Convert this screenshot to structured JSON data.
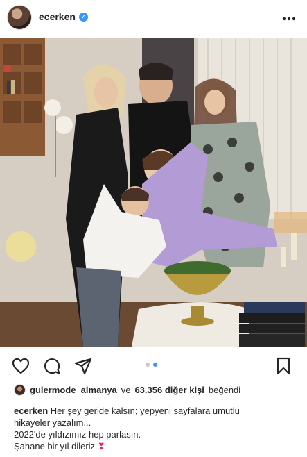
{
  "post": {
    "username": "ecerken",
    "verified_mark": "✓",
    "more_icon": "more-icon",
    "liked_by_user": "gulermode_almanya",
    "likes_connector": "ve",
    "likes_count_text": "63.356 diğer kişi",
    "likes_suffix": "beğendi",
    "caption_username": "ecerken",
    "caption_line1": "Her şey geride kalsın; yepyeni sayfalara umutlu",
    "caption_line2": "hikayeler yazalım...",
    "caption_line3": "2022'de yıldızımız hep parlasın.",
    "caption_line4": "Şahane bir yıl dileriz",
    "caption_emoji": "❣",
    "carousel": {
      "count": 2,
      "active_index": 1
    }
  },
  "icons": [
    "heart-icon",
    "comment-icon",
    "share-icon",
    "save-icon",
    "more-icon",
    "verified-icon"
  ],
  "colors": {
    "accent": "#3897f0",
    "text": "#262626",
    "emoji_red": "#e0245e"
  }
}
